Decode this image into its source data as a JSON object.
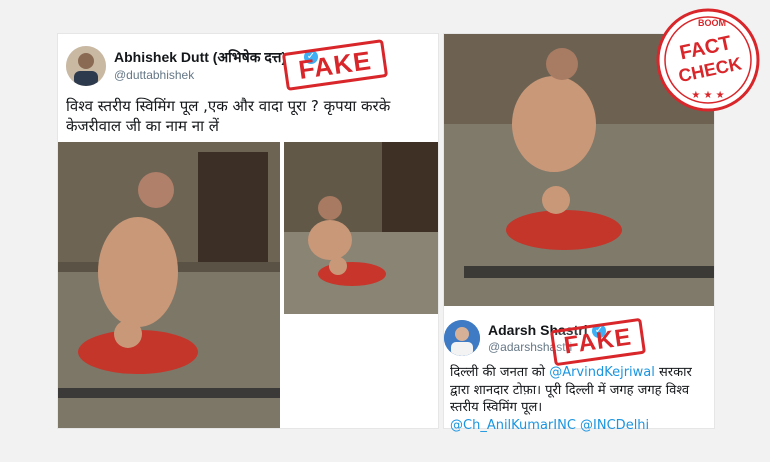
{
  "tweet1": {
    "name": "Abhishek Dutt (अभिषेक दत्त)",
    "handle": "@duttabhishek",
    "text": "विश्व स्तरीय स्विमिंग पूल ,एक और वादा पूरा ? कृपया करके केजरीवाल जी का नाम ना लें"
  },
  "tweet2": {
    "name": "Adarsh Shastri",
    "handle": "@adarshshastri",
    "text_before": "दिल्ली की जनता को ",
    "mention1": "@ArvindKejriwal",
    "text_after": " सरकार द्वारा शानदार टोफ़ा। पूरी दिल्ली में जगह जगह विश्व स्तरीय स्विमिंग पूल।",
    "mention2": "@Ch_AnilKumarINC",
    "mention3": "@INCDelhi"
  },
  "stamps": {
    "fake1": "FAKE",
    "fake2": "FAKE"
  },
  "seal": {
    "top": "BOOM",
    "line1": "FACT",
    "line2": "CHECK"
  },
  "colors": {
    "stamp_red": "#d8262a",
    "link_blue": "#1b95e0",
    "verified_blue": "#1da1f2",
    "background": "#f2f2f2"
  }
}
